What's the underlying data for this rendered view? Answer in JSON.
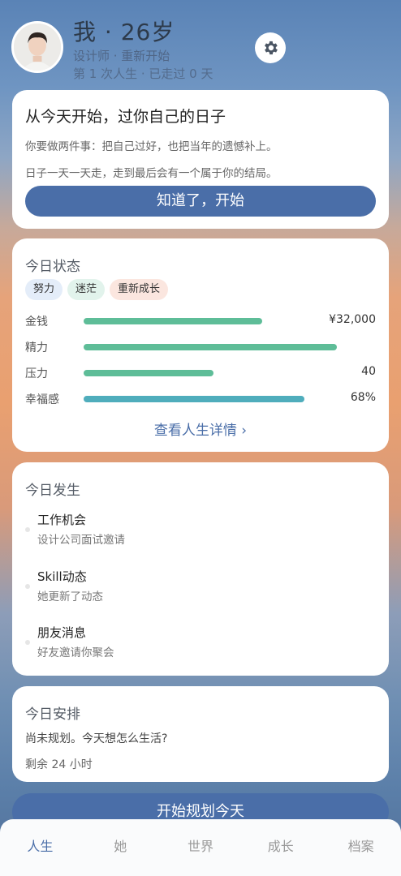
{
  "header": {
    "title": "我 · 26岁",
    "subtitle": "设计师 · 重新开始",
    "subtitle2": "第 1 次人生 · 已走过 0 天",
    "avatar_icon": "avatar",
    "settings_icon": "gear-icon"
  },
  "intro": {
    "title": "从今天开始，过你自己的日子",
    "line1": "你要做两件事：把自己过好，也把当年的遗憾补上。",
    "line2": "日子一天一天走，走到最后会有一个属于你的结局。",
    "button": "知道了，开始"
  },
  "status": {
    "title": "今日状态",
    "tags": [
      "努力",
      "迷茫",
      "重新成长"
    ],
    "rows": [
      {
        "label": "金钱",
        "value": "¥32,000",
        "level": 0.55
      },
      {
        "label": "精力",
        "value": "",
        "level": 0.78
      },
      {
        "label": "压力",
        "value": "40",
        "level": 0.4
      },
      {
        "label": "幸福感",
        "value": "68%",
        "level": 0.68
      }
    ],
    "detail_link": "查看人生详情 ›",
    "colors": {
      "bar": "#5ebd98",
      "bar_happiness": "#4fadbc"
    }
  },
  "happenings": {
    "title": "今日发生",
    "items": [
      {
        "title": "工作机会",
        "desc": "设计公司面试邀请"
      },
      {
        "title": "Skill动态",
        "desc": "她更新了动态"
      },
      {
        "title": "朋友消息",
        "desc": "好友邀请你聚会"
      }
    ]
  },
  "schedule": {
    "title": "今日安排",
    "line1": "尚未规划。今天想怎么生活?",
    "line2": "剩余 24 小时"
  },
  "plan_button": "开始规划今天",
  "tabs": [
    {
      "label": "人生",
      "active": true
    },
    {
      "label": "她",
      "active": false
    },
    {
      "label": "世界",
      "active": false
    },
    {
      "label": "成长",
      "active": false
    },
    {
      "label": "档案",
      "active": false
    }
  ],
  "accent": "#4a6ea8"
}
